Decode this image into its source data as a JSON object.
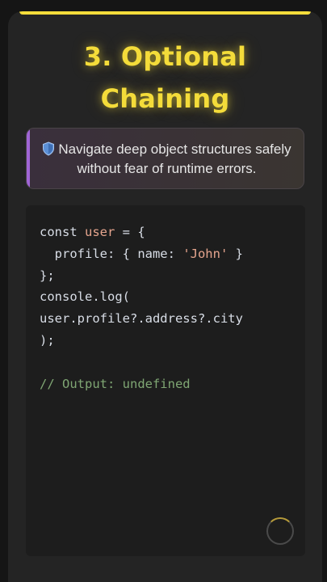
{
  "card": {
    "title_line1": "3. Optional",
    "title_line2": "Chaining",
    "tip": {
      "icon": "shield-icon",
      "text": "Navigate deep object structures safely without fear of runtime errors."
    },
    "code": {
      "lines": [
        [
          {
            "t": "const "
          },
          {
            "t": "user",
            "c": "var"
          },
          {
            "t": " = {"
          }
        ],
        [
          {
            "t": "  profile: { name: "
          },
          {
            "t": "'John'",
            "c": "str"
          },
          {
            "t": " }"
          }
        ],
        [
          {
            "t": "};"
          }
        ],
        [
          {
            "t": "console.log("
          }
        ],
        [
          {
            "t": "user.profile?.address?.city"
          }
        ],
        [
          {
            "t": ");"
          }
        ],
        [
          {
            "t": ""
          }
        ],
        [
          {
            "t": "// Output: undefined",
            "c": "comment"
          }
        ]
      ]
    }
  },
  "colors": {
    "accent_yellow": "#f4dc3a",
    "tip_accent": "#a065d6",
    "string": "#e6a58e",
    "comment": "#7fa673"
  }
}
